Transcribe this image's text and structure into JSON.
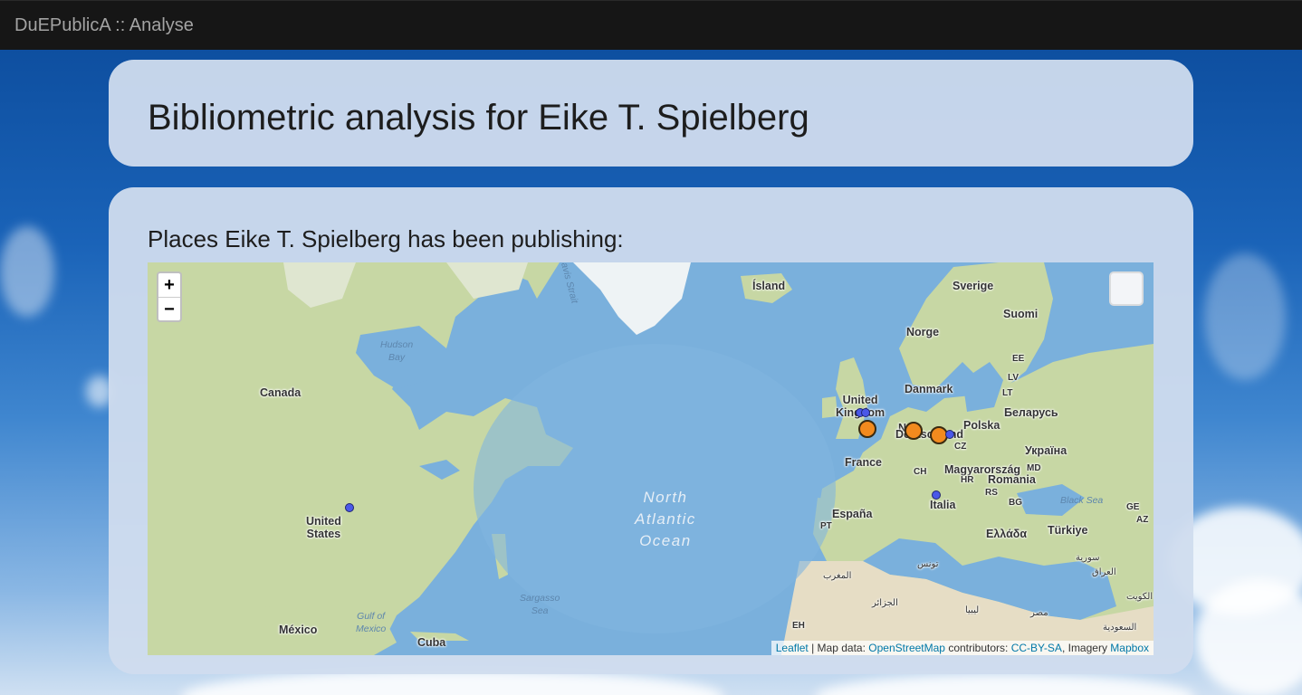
{
  "navbar": {
    "brand": "DuEPublicA :: Analyse"
  },
  "header": {
    "title": "Bibliometric analysis for Eike T. Spielberg"
  },
  "section": {
    "heading": "Places Eike T. Spielberg has been publishing:"
  },
  "map": {
    "zoom_in_label": "+",
    "zoom_out_label": "−",
    "labels": {
      "island": "Ísland",
      "sverige": "Sverige",
      "suomi": "Suomi",
      "norge": "Norge",
      "danmark": "Danmark",
      "uk": "United\nKingdom",
      "polska": "Polska",
      "belarus": "Беларусь",
      "ukraina": "Україна",
      "cz": "CZ",
      "ch": "CH",
      "magyar": "Magyarország",
      "md": "MD",
      "romania": "Romania",
      "hr": "HR",
      "rs": "RS",
      "bg": "BG",
      "france": "France",
      "espana": "España",
      "pt": "PT",
      "italia": "Italia",
      "ellada": "Ελλάδα",
      "turkiye": "Türkiye",
      "ge": "GE",
      "az": "AZ",
      "black_sea": "Black Sea",
      "ee": "EE",
      "lv": "LV",
      "lt": "LT",
      "canada": "Canada",
      "us": "United\nStates",
      "mexico": "México",
      "cuba": "Cuba",
      "hudson": "Hudson\nBay",
      "gulf": "Gulf of\nMexico",
      "sargasso": "Sargasso\nSea",
      "ocean": "North\nAtlantic\nOcean",
      "davis": "Davis Strait",
      "maghrib": "المغرب",
      "jazair": "الجزائر",
      "tunis": "تونس",
      "libya": "ليبيا",
      "misr": "مصر",
      "iraq": "العراق",
      "suriya": "سورية",
      "saudi": "السعودية",
      "kuwait": "الكويت",
      "eh": "EH",
      "de": "Deutschland",
      "nl": "N"
    },
    "markers": [
      {
        "name": "marker-usa",
        "type": "blue"
      },
      {
        "name": "marker-uk-1",
        "type": "blue"
      },
      {
        "name": "marker-uk-2",
        "type": "blue"
      },
      {
        "name": "marker-uk-orange",
        "type": "orange"
      },
      {
        "name": "marker-germany-west",
        "type": "orange"
      },
      {
        "name": "marker-germany-east",
        "type": "orange"
      },
      {
        "name": "marker-poland",
        "type": "blue"
      },
      {
        "name": "marker-italy",
        "type": "blue"
      }
    ],
    "attribution": {
      "leaflet": "Leaflet",
      "sep1": " | Map data: ",
      "osm": "OpenStreetMap",
      "contrib": " contributors: ",
      "license": "CC-BY-SA",
      "imagery": ", Imagery ",
      "mapbox": "Mapbox"
    },
    "colors": {
      "water": "#7ab0dc",
      "land": "#c9d9a8",
      "ice": "#f2f4f4",
      "desert": "#e8dfc8"
    }
  }
}
